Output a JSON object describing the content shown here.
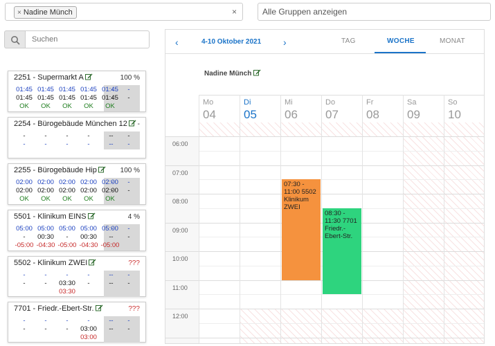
{
  "filters": {
    "user_tag": "Nadine Münch",
    "tag_remove": "×",
    "clear": "×",
    "group_placeholder": "Alle Gruppen anzeigen"
  },
  "search": {
    "placeholder": "Suchen"
  },
  "cards": [
    {
      "title": "2251 - Supermarkt A",
      "pct": "100 %",
      "pct_color": "#333333",
      "rows": [
        {
          "cells": [
            "01:45",
            "01:45",
            "01:45",
            "01:45",
            "01:45",
            "-",
            "-"
          ],
          "color": "blue"
        },
        {
          "cells": [
            "01:45",
            "01:45",
            "01:45",
            "01:45",
            "01:45",
            "-",
            "-"
          ],
          "color": "dark"
        },
        {
          "cells": [
            "OK",
            "OK",
            "OK",
            "OK",
            "OK",
            "",
            ""
          ],
          "color": "green"
        }
      ]
    },
    {
      "title": "2254 - Bürogebäude München 12",
      "pct": "-",
      "pct_color": "#333333",
      "rows": [
        {
          "cells": [
            "-",
            "-",
            "-",
            "-",
            "-",
            "-",
            "-"
          ],
          "color": "dark"
        },
        {
          "cells": [
            "-",
            "-",
            "-",
            "-",
            "-",
            "-",
            "-"
          ],
          "color": "blue"
        }
      ]
    },
    {
      "title": "2255 - Bürogebäude Hip",
      "pct": "100 %",
      "pct_color": "#333333",
      "rows": [
        {
          "cells": [
            "02:00",
            "02:00",
            "02:00",
            "02:00",
            "02:00",
            "-",
            "-"
          ],
          "color": "blue"
        },
        {
          "cells": [
            "02:00",
            "02:00",
            "02:00",
            "02:00",
            "02:00",
            "-",
            "-"
          ],
          "color": "dark"
        },
        {
          "cells": [
            "OK",
            "OK",
            "OK",
            "OK",
            "OK",
            "",
            ""
          ],
          "color": "green"
        }
      ]
    },
    {
      "title": "5501 - Klinikum EINS",
      "pct": "4 %",
      "pct_color": "#333333",
      "rows": [
        {
          "cells": [
            "05:00",
            "05:00",
            "05:00",
            "05:00",
            "05:00",
            "-",
            "-"
          ],
          "color": "blue"
        },
        {
          "cells": [
            "-",
            "00:30",
            "-",
            "00:30",
            "-",
            "-",
            "-"
          ],
          "color": "dark"
        },
        {
          "cells": [
            "-05:00",
            "-04:30",
            "-05:00",
            "-04:30",
            "-05:00",
            "",
            ""
          ],
          "color": "red"
        }
      ]
    },
    {
      "title": "5502 - Klinikum ZWEI",
      "pct": "???",
      "pct_color": "#cc3333",
      "rows": [
        {
          "cells": [
            "-",
            "-",
            "-",
            "-",
            "-",
            "-",
            "-"
          ],
          "color": "blue"
        },
        {
          "cells": [
            "-",
            "-",
            "03:30",
            "-",
            "-",
            "-",
            "-"
          ],
          "color": "dark"
        },
        {
          "cells": [
            "",
            "",
            "03:30",
            "",
            "",
            "",
            ""
          ],
          "color": "red"
        }
      ]
    },
    {
      "title": "7701 - Friedr.-Ebert-Str.",
      "pct": "???",
      "pct_color": "#cc3333",
      "rows": [
        {
          "cells": [
            "-",
            "-",
            "-",
            "-",
            "-",
            "-",
            "-"
          ],
          "color": "blue"
        },
        {
          "cells": [
            "-",
            "-",
            "-",
            "03:00",
            "-",
            "-",
            "-"
          ],
          "color": "dark"
        },
        {
          "cells": [
            "",
            "",
            "",
            "03:00",
            "",
            "",
            ""
          ],
          "color": "red"
        }
      ]
    }
  ],
  "calendar": {
    "prev": "‹",
    "next": "›",
    "range": "4-10 Oktober 2021",
    "views": [
      "TAG",
      "WOCHE",
      "MONAT"
    ],
    "active_view": "WOCHE",
    "resource": "Nadine Münch",
    "days": [
      {
        "name": "Mo",
        "num": "04",
        "today": false,
        "off": false
      },
      {
        "name": "Di",
        "num": "05",
        "today": true,
        "off": false
      },
      {
        "name": "Mi",
        "num": "06",
        "today": false,
        "off": false
      },
      {
        "name": "Do",
        "num": "07",
        "today": false,
        "off": false
      },
      {
        "name": "Fr",
        "num": "08",
        "today": false,
        "off": false
      },
      {
        "name": "Sa",
        "num": "09",
        "today": false,
        "off": true
      },
      {
        "name": "So",
        "num": "10",
        "today": false,
        "off": true
      }
    ],
    "hours": [
      "06:00",
      "07:00",
      "08:00",
      "09:00",
      "10:00",
      "11:00",
      "12:00"
    ],
    "events": [
      {
        "day": 2,
        "start": 7.5,
        "end": 11.0,
        "text": "07:30 - 11:00 5502 Klinikum ZWEI",
        "color": "#f5923e"
      },
      {
        "day": 3,
        "start": 8.5,
        "end": 11.5,
        "text": "08:30 - 11:30 7701 Friedr.-Ebert-Str.",
        "color": "#2ed47e"
      }
    ]
  }
}
